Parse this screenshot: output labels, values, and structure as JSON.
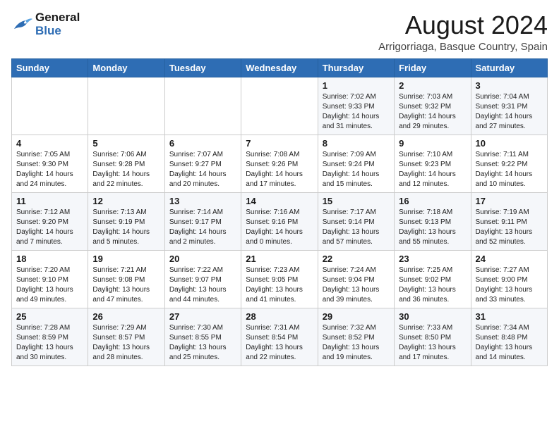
{
  "logo": {
    "line1": "General",
    "line2": "Blue"
  },
  "title": "August 2024",
  "subtitle": "Arrigorriaga, Basque Country, Spain",
  "weekdays": [
    "Sunday",
    "Monday",
    "Tuesday",
    "Wednesday",
    "Thursday",
    "Friday",
    "Saturday"
  ],
  "weeks": [
    [
      {
        "day": "",
        "info": ""
      },
      {
        "day": "",
        "info": ""
      },
      {
        "day": "",
        "info": ""
      },
      {
        "day": "",
        "info": ""
      },
      {
        "day": "1",
        "info": "Sunrise: 7:02 AM\nSunset: 9:33 PM\nDaylight: 14 hours and 31 minutes."
      },
      {
        "day": "2",
        "info": "Sunrise: 7:03 AM\nSunset: 9:32 PM\nDaylight: 14 hours and 29 minutes."
      },
      {
        "day": "3",
        "info": "Sunrise: 7:04 AM\nSunset: 9:31 PM\nDaylight: 14 hours and 27 minutes."
      }
    ],
    [
      {
        "day": "4",
        "info": "Sunrise: 7:05 AM\nSunset: 9:30 PM\nDaylight: 14 hours and 24 minutes."
      },
      {
        "day": "5",
        "info": "Sunrise: 7:06 AM\nSunset: 9:28 PM\nDaylight: 14 hours and 22 minutes."
      },
      {
        "day": "6",
        "info": "Sunrise: 7:07 AM\nSunset: 9:27 PM\nDaylight: 14 hours and 20 minutes."
      },
      {
        "day": "7",
        "info": "Sunrise: 7:08 AM\nSunset: 9:26 PM\nDaylight: 14 hours and 17 minutes."
      },
      {
        "day": "8",
        "info": "Sunrise: 7:09 AM\nSunset: 9:24 PM\nDaylight: 14 hours and 15 minutes."
      },
      {
        "day": "9",
        "info": "Sunrise: 7:10 AM\nSunset: 9:23 PM\nDaylight: 14 hours and 12 minutes."
      },
      {
        "day": "10",
        "info": "Sunrise: 7:11 AM\nSunset: 9:22 PM\nDaylight: 14 hours and 10 minutes."
      }
    ],
    [
      {
        "day": "11",
        "info": "Sunrise: 7:12 AM\nSunset: 9:20 PM\nDaylight: 14 hours and 7 minutes."
      },
      {
        "day": "12",
        "info": "Sunrise: 7:13 AM\nSunset: 9:19 PM\nDaylight: 14 hours and 5 minutes."
      },
      {
        "day": "13",
        "info": "Sunrise: 7:14 AM\nSunset: 9:17 PM\nDaylight: 14 hours and 2 minutes."
      },
      {
        "day": "14",
        "info": "Sunrise: 7:16 AM\nSunset: 9:16 PM\nDaylight: 14 hours and 0 minutes."
      },
      {
        "day": "15",
        "info": "Sunrise: 7:17 AM\nSunset: 9:14 PM\nDaylight: 13 hours and 57 minutes."
      },
      {
        "day": "16",
        "info": "Sunrise: 7:18 AM\nSunset: 9:13 PM\nDaylight: 13 hours and 55 minutes."
      },
      {
        "day": "17",
        "info": "Sunrise: 7:19 AM\nSunset: 9:11 PM\nDaylight: 13 hours and 52 minutes."
      }
    ],
    [
      {
        "day": "18",
        "info": "Sunrise: 7:20 AM\nSunset: 9:10 PM\nDaylight: 13 hours and 49 minutes."
      },
      {
        "day": "19",
        "info": "Sunrise: 7:21 AM\nSunset: 9:08 PM\nDaylight: 13 hours and 47 minutes."
      },
      {
        "day": "20",
        "info": "Sunrise: 7:22 AM\nSunset: 9:07 PM\nDaylight: 13 hours and 44 minutes."
      },
      {
        "day": "21",
        "info": "Sunrise: 7:23 AM\nSunset: 9:05 PM\nDaylight: 13 hours and 41 minutes."
      },
      {
        "day": "22",
        "info": "Sunrise: 7:24 AM\nSunset: 9:04 PM\nDaylight: 13 hours and 39 minutes."
      },
      {
        "day": "23",
        "info": "Sunrise: 7:25 AM\nSunset: 9:02 PM\nDaylight: 13 hours and 36 minutes."
      },
      {
        "day": "24",
        "info": "Sunrise: 7:27 AM\nSunset: 9:00 PM\nDaylight: 13 hours and 33 minutes."
      }
    ],
    [
      {
        "day": "25",
        "info": "Sunrise: 7:28 AM\nSunset: 8:59 PM\nDaylight: 13 hours and 30 minutes."
      },
      {
        "day": "26",
        "info": "Sunrise: 7:29 AM\nSunset: 8:57 PM\nDaylight: 13 hours and 28 minutes."
      },
      {
        "day": "27",
        "info": "Sunrise: 7:30 AM\nSunset: 8:55 PM\nDaylight: 13 hours and 25 minutes."
      },
      {
        "day": "28",
        "info": "Sunrise: 7:31 AM\nSunset: 8:54 PM\nDaylight: 13 hours and 22 minutes."
      },
      {
        "day": "29",
        "info": "Sunrise: 7:32 AM\nSunset: 8:52 PM\nDaylight: 13 hours and 19 minutes."
      },
      {
        "day": "30",
        "info": "Sunrise: 7:33 AM\nSunset: 8:50 PM\nDaylight: 13 hours and 17 minutes."
      },
      {
        "day": "31",
        "info": "Sunrise: 7:34 AM\nSunset: 8:48 PM\nDaylight: 13 hours and 14 minutes."
      }
    ]
  ]
}
